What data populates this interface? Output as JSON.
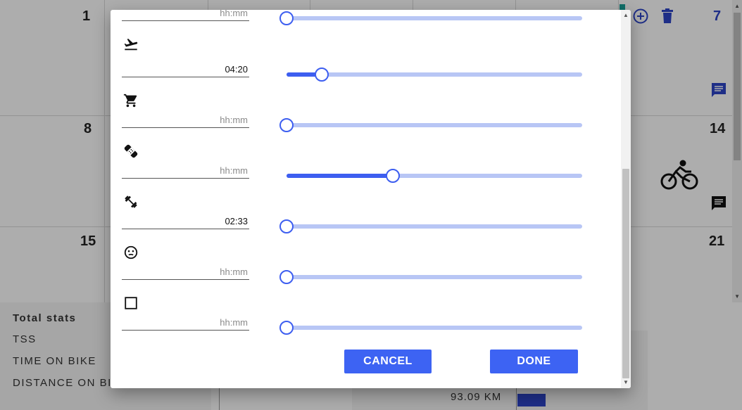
{
  "calendar": {
    "day_numbers": {
      "d1": "1",
      "d7": "7",
      "d8": "8",
      "d14": "14",
      "d15": "15",
      "d21": "21"
    },
    "accent_color": "#2d45c8",
    "icons": [
      "add-circle-icon",
      "delete-icon",
      "comment-icon",
      "bicycle-icon",
      "comment-icon"
    ]
  },
  "stats": {
    "title": "Total stats",
    "labels": {
      "tss": "TSS",
      "time_on_bike": "TIME ON BIKE",
      "distance_on_bike": "DISTANCE ON BIK"
    },
    "distance_value": "93.09 KM"
  },
  "dialog": {
    "rows": [
      {
        "icon": "hidden-icon",
        "value": "",
        "placeholder": "hh:mm",
        "slider_fraction": 0.0
      },
      {
        "icon": "airplane-takeoff-icon",
        "value": "04:20",
        "placeholder": "",
        "slider_fraction": 0.12
      },
      {
        "icon": "shopping-cart-icon",
        "value": "",
        "placeholder": "hh:mm",
        "slider_fraction": 0.0
      },
      {
        "icon": "bandage-icon",
        "value": "",
        "placeholder": "hh:mm",
        "slider_fraction": 0.36
      },
      {
        "icon": "dumbbell-icon",
        "value": "02:33",
        "placeholder": "",
        "slider_fraction": 0.0
      },
      {
        "icon": "neutral-face-icon",
        "value": "",
        "placeholder": "hh:mm",
        "slider_fraction": 0.0
      },
      {
        "icon": "square-icon",
        "value": "",
        "placeholder": "hh:mm",
        "slider_fraction": 0.0
      }
    ],
    "cancel_label": "CANCEL",
    "done_label": "DONE",
    "button_color": "#3d63f3",
    "slider_active_color": "#3d5ef0",
    "slider_track_color": "#b8c6f5"
  }
}
